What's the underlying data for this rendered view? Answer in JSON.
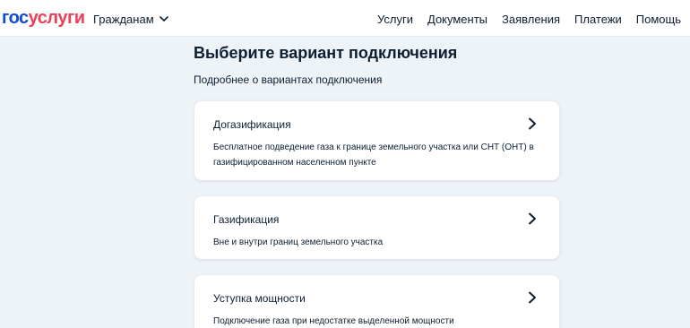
{
  "header": {
    "logo": {
      "part1": "гос",
      "part2": "услуги"
    },
    "audience_label": "Гражданам",
    "nav": [
      "Услуги",
      "Документы",
      "Заявления",
      "Платежи",
      "Помощь"
    ]
  },
  "main": {
    "title": "Выберите вариант подключения",
    "more_link": "Подробнее о вариантах подключения",
    "options": [
      {
        "title": "Догазификация",
        "description": "Бесплатное подведение газа к границе земельного участка или СНТ (ОНТ) в газифицированном населенном пункте",
        "icon": "chevron-right-icon"
      },
      {
        "title": "Газификация",
        "description": "Вне и внутри границ земельного участка",
        "icon": "chevron-right-icon"
      },
      {
        "title": "Уступка мощности",
        "description": "Подключение газа при недостатке выделенной мощности",
        "icon": "chevron-right-icon"
      }
    ]
  },
  "colors": {
    "background": "#eef3f8",
    "text": "#0b1f33",
    "brand_blue": "#0d4cd3",
    "brand_red": "#ee3f58",
    "card": "#ffffff"
  }
}
